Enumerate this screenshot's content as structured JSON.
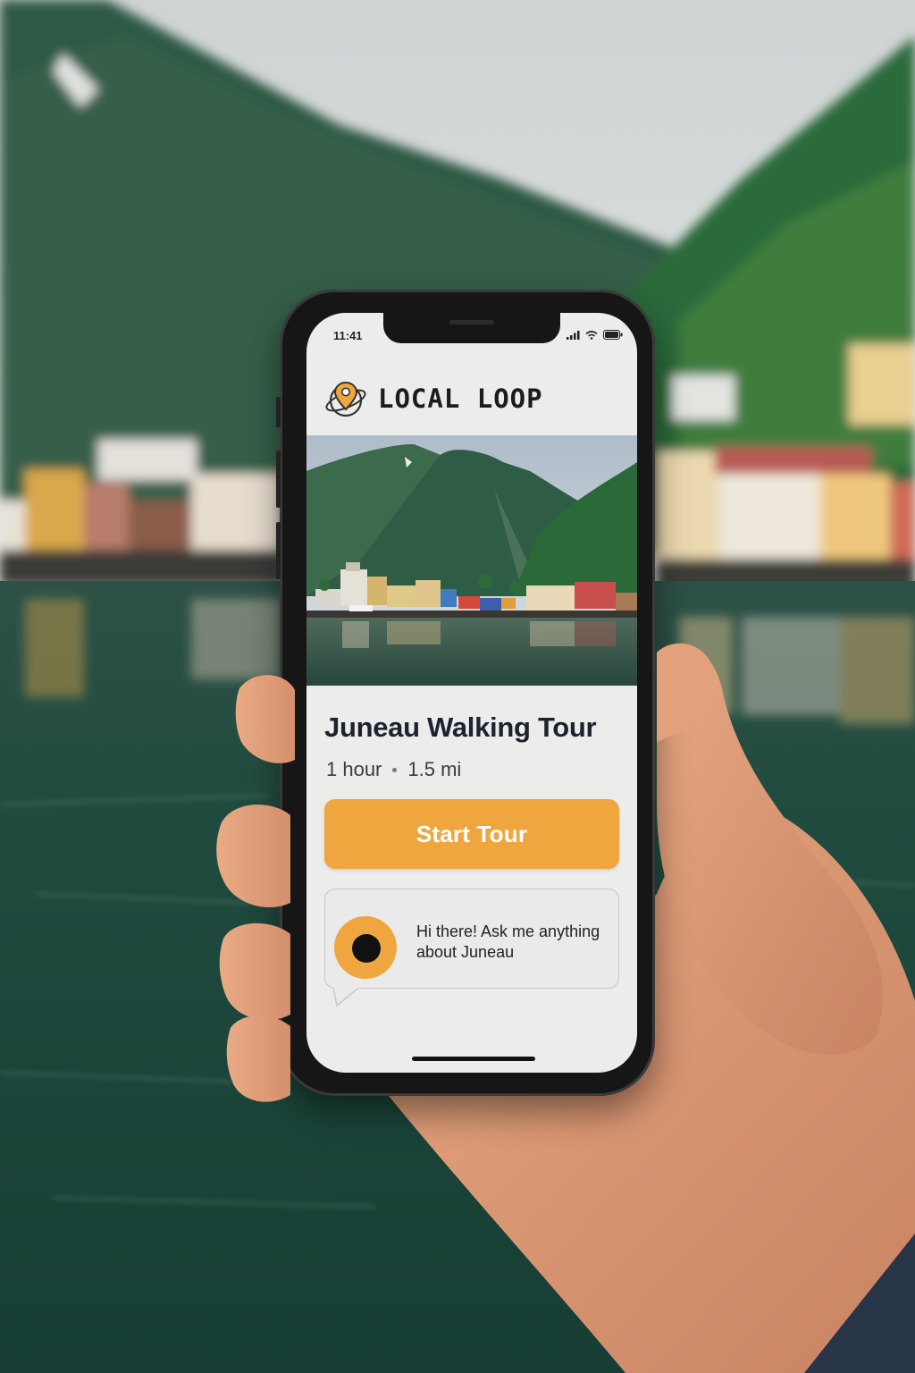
{
  "status_bar": {
    "time": "11:41"
  },
  "brand": {
    "name": "LOCAL LOOP",
    "logo_icon": "map-pin-globe-icon"
  },
  "tour": {
    "title": "Juneau Walking Tour",
    "duration": "1 hour",
    "distance": "1.5 mi",
    "start_label": "Start Tour"
  },
  "assistant": {
    "message": "Hi there! Ask me anything about Juneau",
    "avatar_icon": "eye-avatar-icon"
  },
  "colors": {
    "accent": "#f0a63f",
    "screen_bg": "#ececea",
    "title_text": "#1d2230"
  }
}
